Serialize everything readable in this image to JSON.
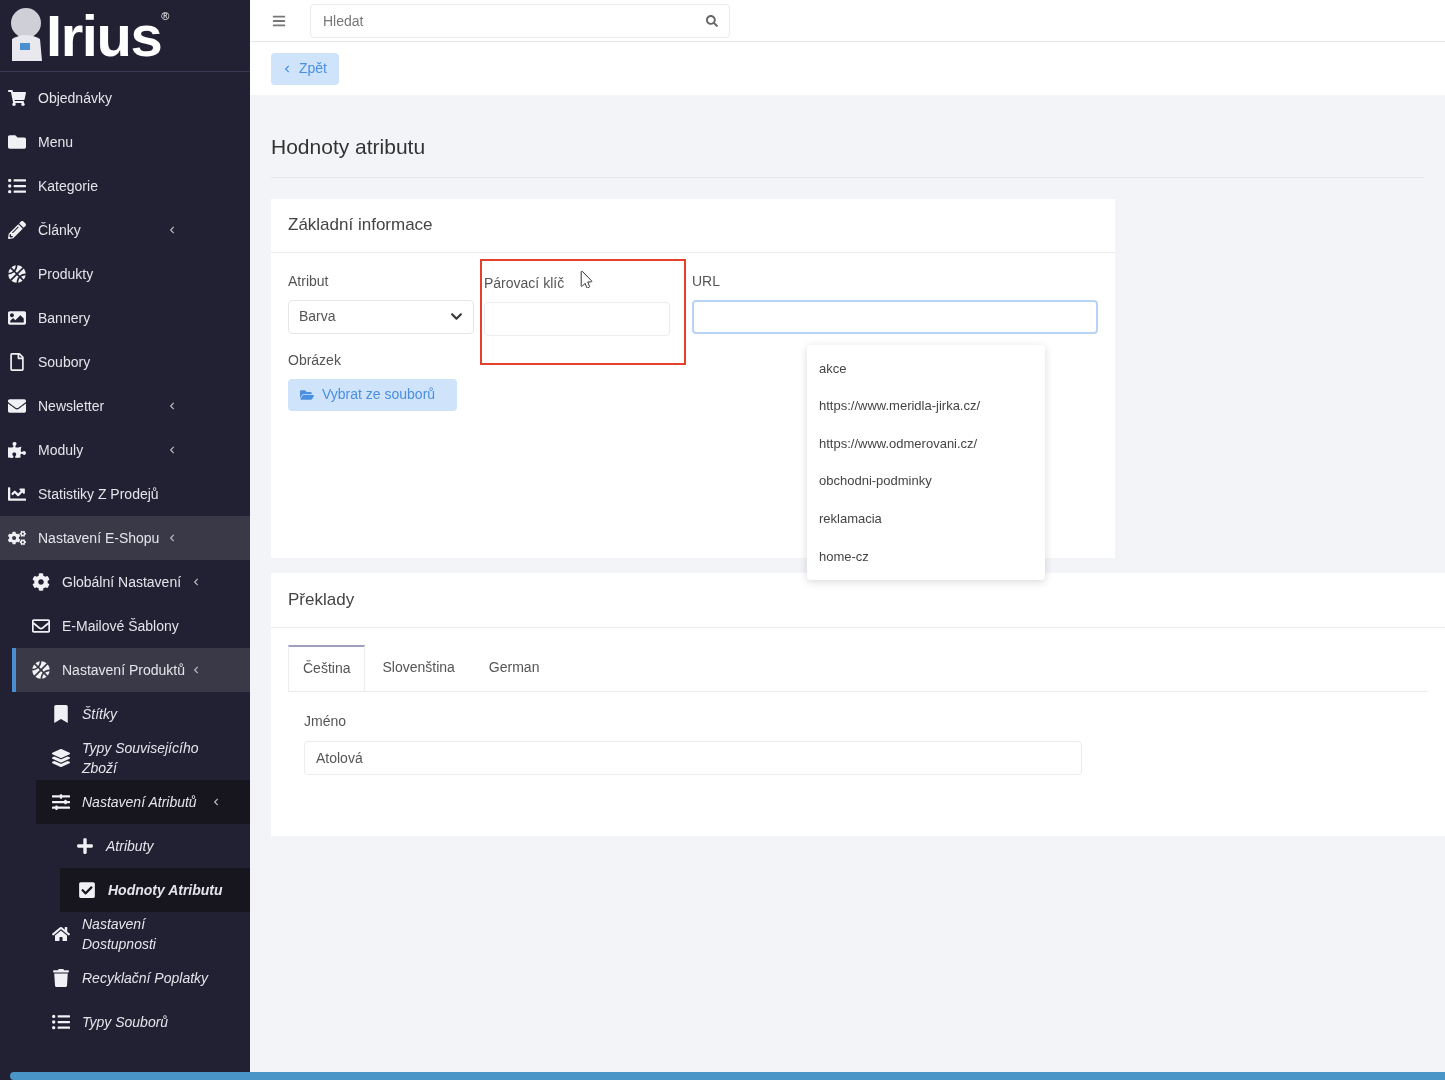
{
  "logo": {
    "text": "Irius",
    "mark": "®"
  },
  "sidebar": {
    "items": [
      {
        "label": "Objednávky",
        "expandable": false,
        "expanded": false
      },
      {
        "label": "Menu",
        "expandable": false,
        "expanded": false
      },
      {
        "label": "Kategorie",
        "expandable": false,
        "expanded": false
      },
      {
        "label": "Články",
        "expandable": true,
        "expanded": false
      },
      {
        "label": "Produkty",
        "expandable": false,
        "expanded": false
      },
      {
        "label": "Bannery",
        "expandable": false,
        "expanded": false
      },
      {
        "label": "Soubory",
        "expandable": false,
        "expanded": false
      },
      {
        "label": "Newsletter",
        "expandable": true,
        "expanded": false
      },
      {
        "label": "Moduly",
        "expandable": true,
        "expanded": false
      },
      {
        "label": "Statistiky Z Prodejů",
        "expandable": false,
        "expanded": false
      },
      {
        "label": "Nastavení E-Shopu",
        "expandable": true,
        "expanded": true,
        "children": [
          {
            "label": "Globální Nastavení",
            "expandable": true,
            "expanded": false
          },
          {
            "label": "E-Mailové Šablony",
            "expandable": false,
            "expanded": false
          },
          {
            "label": "Nastavení Produktů",
            "expandable": true,
            "expanded": true,
            "children": [
              {
                "label": "Štítky",
                "expandable": false,
                "expanded": false
              },
              {
                "label": "Typy Souvisejícího Zboží",
                "expandable": false,
                "expanded": false
              },
              {
                "label": "Nastavení Atributů",
                "expandable": true,
                "expanded": true,
                "children": [
                  {
                    "label": "Atributy",
                    "selected": false
                  },
                  {
                    "label": "Hodnoty Atributu",
                    "selected": true
                  }
                ]
              },
              {
                "label": "Nastavení Dostupnosti",
                "expandable": false,
                "expanded": false
              },
              {
                "label": "Recyklační Poplatky",
                "expandable": false,
                "expanded": false
              },
              {
                "label": "Typy Souborů",
                "expandable": false,
                "expanded": false
              }
            ]
          }
        ]
      }
    ]
  },
  "topbar": {
    "search": {
      "placeholder": "Hledat"
    }
  },
  "back_button": {
    "label": "Zpět"
  },
  "page_title": "Hodnoty atributu",
  "basic_info": {
    "title": "Základní informace",
    "attribute": {
      "label": "Atribut",
      "value": "Barva"
    },
    "pairing_key": {
      "label": "Párovací klíč",
      "highlighted": true
    },
    "url": {
      "label": "URL",
      "focused": true,
      "suggestions": [
        "akce",
        "https://www.meridla-jirka.cz/",
        "https://www.odmerovani.cz/",
        "obchodni-podminky",
        "reklamacia",
        "home-cz"
      ]
    },
    "image": {
      "label": "Obrázek",
      "button": "Vybrat ze souborů"
    }
  },
  "translations": {
    "title": "Překlady",
    "tabs": [
      {
        "label": "Čeština",
        "selected": true
      },
      {
        "label": "Slovenština",
        "selected": false
      },
      {
        "label": "German",
        "selected": false
      }
    ],
    "name": {
      "label": "Jméno",
      "value": "Atolová"
    }
  }
}
